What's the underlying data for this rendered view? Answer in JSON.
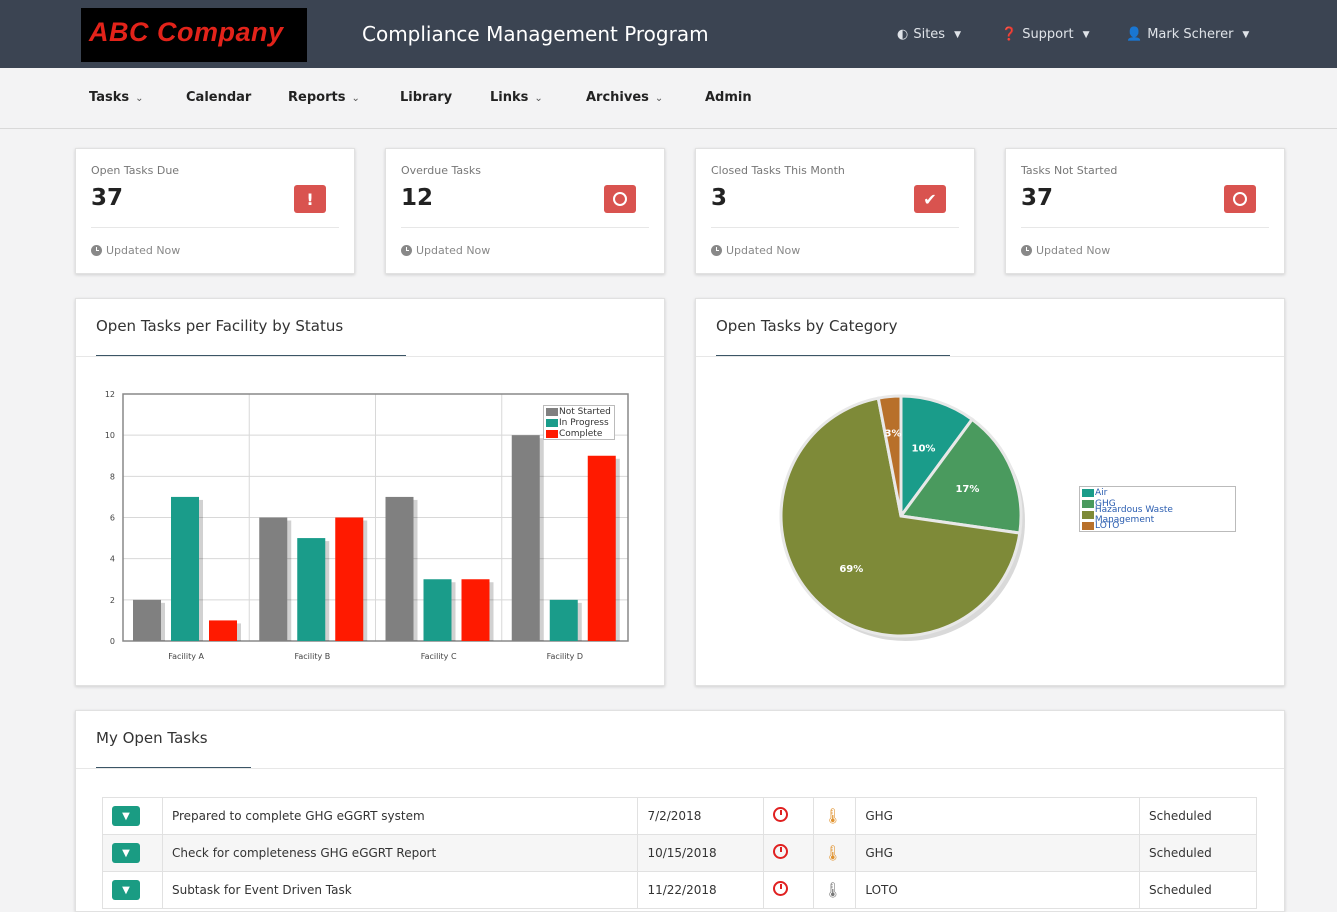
{
  "brand": "ABC Company",
  "app_title": "Compliance Management Program",
  "top_nav": {
    "sites": "Sites",
    "support": "Support",
    "user": "Mark Scherer"
  },
  "sub_nav": [
    {
      "label": "Tasks",
      "has_menu": true
    },
    {
      "label": "Calendar",
      "has_menu": false
    },
    {
      "label": "Reports",
      "has_menu": true
    },
    {
      "label": "Library",
      "has_menu": false
    },
    {
      "label": "Links",
      "has_menu": true
    },
    {
      "label": "Archives",
      "has_menu": true
    },
    {
      "label": "Admin",
      "has_menu": false
    }
  ],
  "stats": [
    {
      "label": "Open Tasks Due",
      "value": "37",
      "icon": "exclamation-icon",
      "updated": "Updated Now"
    },
    {
      "label": "Overdue Tasks",
      "value": "12",
      "icon": "clock-icon",
      "updated": "Updated Now"
    },
    {
      "label": "Closed Tasks This Month",
      "value": "3",
      "icon": "check-icon",
      "updated": "Updated Now"
    },
    {
      "label": "Tasks Not Started",
      "value": "37",
      "icon": "circle-icon",
      "updated": "Updated Now"
    }
  ],
  "panels": {
    "bar_title": "Open Tasks per Facility by Status",
    "pie_title": "Open Tasks by Category",
    "tasks_title": "My Open Tasks"
  },
  "chart_data": [
    {
      "type": "bar",
      "title": "Open Tasks per Facility by Status",
      "categories": [
        "Facility A",
        "Facility B",
        "Facility C",
        "Facility D"
      ],
      "series": [
        {
          "name": "Not Started",
          "color": "#808080",
          "values": [
            2,
            6,
            7,
            10
          ]
        },
        {
          "name": "In Progress",
          "color": "#1a9c8a",
          "values": [
            7,
            5,
            3,
            2
          ]
        },
        {
          "name": "Complete",
          "color": "#ff1a00",
          "values": [
            1,
            6,
            3,
            9
          ]
        }
      ],
      "ylim": [
        0,
        12
      ],
      "yticks": [
        0,
        2,
        4,
        6,
        8,
        10,
        12
      ],
      "grid": true,
      "legend": "top-right"
    },
    {
      "type": "pie",
      "title": "Open Tasks by Category",
      "slices": [
        {
          "label": "Air",
          "value": 10,
          "display": "10%",
          "color": "#1a9c8a"
        },
        {
          "label": "GHG",
          "value": 17,
          "display": "17%",
          "color": "#4a9a5e"
        },
        {
          "label": "Hazardous Waste Management",
          "value": 69,
          "display": "69%",
          "color": "#7e8a38"
        },
        {
          "label": "LOTO",
          "value": 3,
          "display": "3%",
          "color": "#b8702a"
        }
      ],
      "legend": "right"
    }
  ],
  "tasks": [
    {
      "name": "Prepared to complete GHG eGGRT system",
      "date": "7/2/2018",
      "category": "GHG",
      "status": "Scheduled",
      "therm": "orange"
    },
    {
      "name": "Check for completeness GHG eGGRT Report",
      "date": "10/15/2018",
      "category": "GHG",
      "status": "Scheduled",
      "therm": "orange"
    },
    {
      "name": "Subtask for Event Driven Task",
      "date": "11/22/2018",
      "category": "LOTO",
      "status": "Scheduled",
      "therm": "grey"
    }
  ]
}
